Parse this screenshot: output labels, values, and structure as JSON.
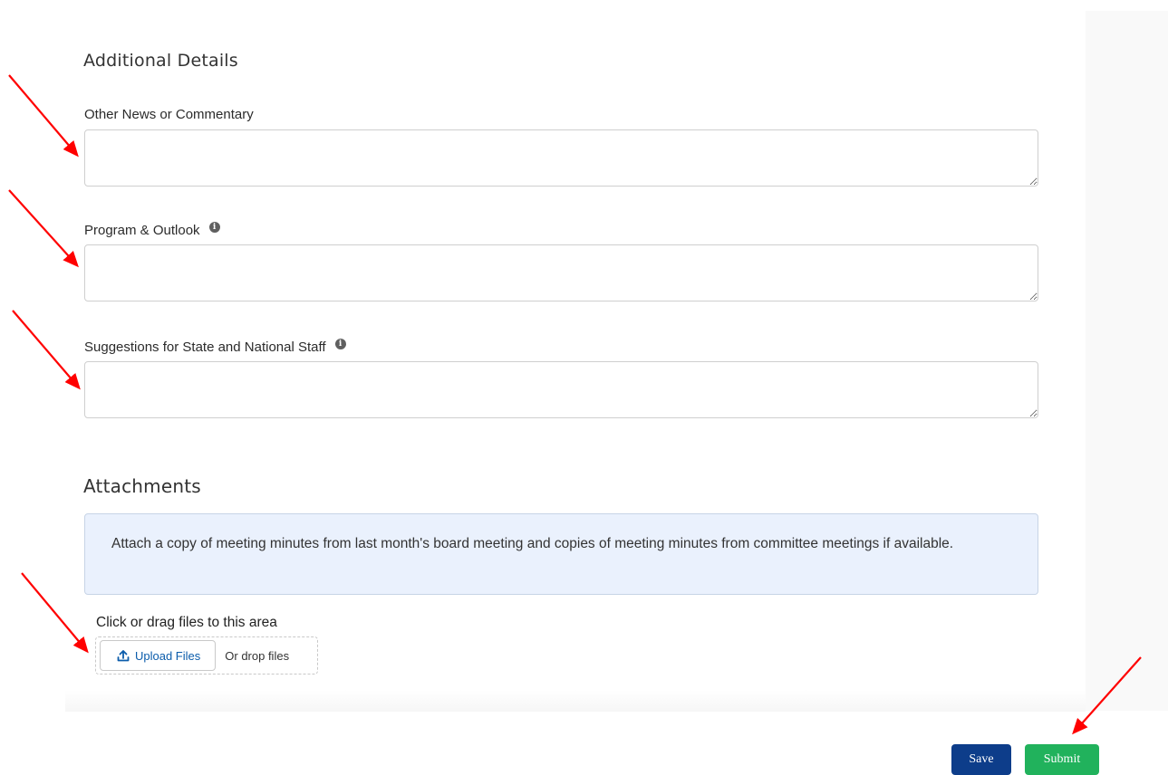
{
  "sections": {
    "details_heading": "Additional Details",
    "attachments_heading": "Attachments"
  },
  "fields": [
    {
      "label": "Other News or Commentary",
      "has_info": false,
      "value": ""
    },
    {
      "label": "Program & Outlook",
      "has_info": true,
      "value": ""
    },
    {
      "label": "Suggestions for State and National Staff",
      "has_info": true,
      "value": ""
    }
  ],
  "attachments": {
    "notice": "Attach a copy of meeting minutes from last month's board meeting and copies of meeting minutes from committee meetings if available.",
    "drop_label": "Click or drag files to this area",
    "upload_button": "Upload Files",
    "drop_text": "Or drop files"
  },
  "actions": {
    "save": "Save",
    "submit": "Submit"
  },
  "colors": {
    "annotation_arrow": "#ff0000",
    "save_button": "#0d3d8a",
    "submit_button": "#21b25c",
    "link_blue": "#0b5cab"
  },
  "icons": {
    "info": "info-icon",
    "upload": "upload-icon"
  }
}
